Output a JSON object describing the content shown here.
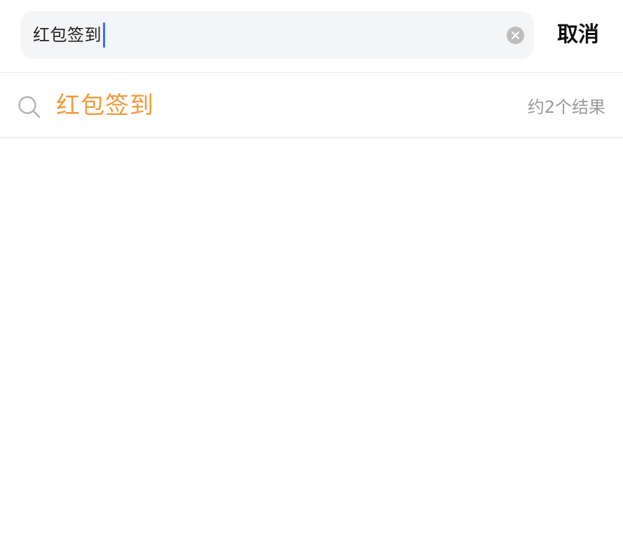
{
  "search": {
    "value": "红包签到",
    "cancel_label": "取消"
  },
  "suggestion": {
    "term": "红包签到",
    "count_text": "约2个结果"
  },
  "colors": {
    "highlight": "#ee9a3a",
    "caret": "#3d6ff0",
    "input_background": "#f4f5f7"
  },
  "icons": {
    "clear": "clear-icon",
    "search": "search-icon"
  }
}
